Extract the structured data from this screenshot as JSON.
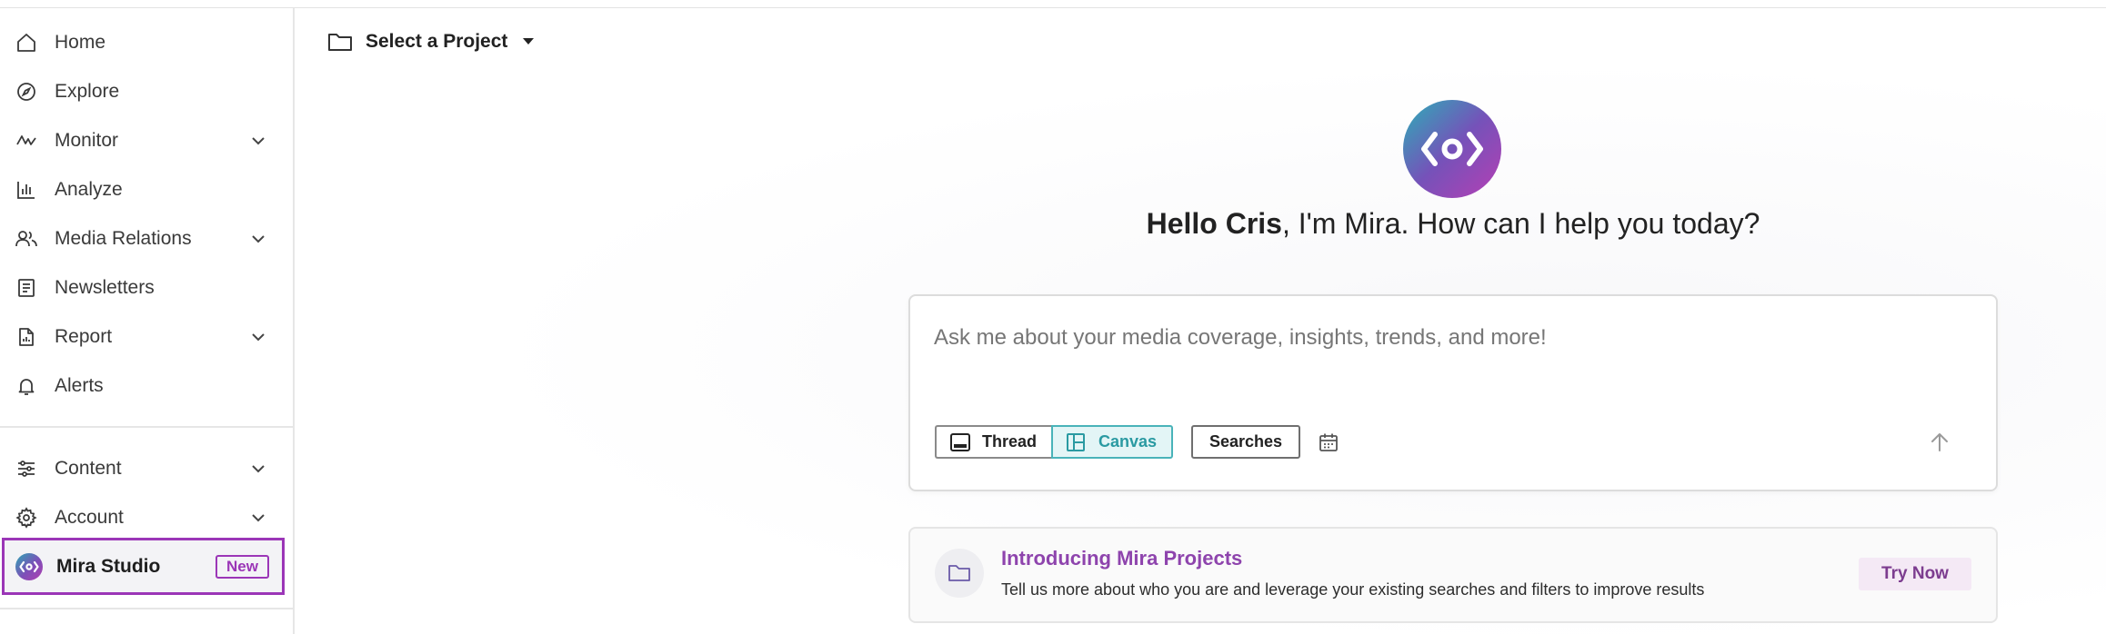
{
  "sidebar": {
    "items": [
      {
        "label": "Home",
        "icon": "home-icon"
      },
      {
        "label": "Explore",
        "icon": "compass-icon"
      },
      {
        "label": "Monitor",
        "icon": "pulse-icon"
      },
      {
        "label": "Analyze",
        "icon": "bar-chart-icon"
      },
      {
        "label": "Media Relations",
        "icon": "people-icon"
      },
      {
        "label": "Newsletters",
        "icon": "newsletter-icon"
      },
      {
        "label": "Report",
        "icon": "report-icon"
      },
      {
        "label": "Alerts",
        "icon": "bell-icon"
      },
      {
        "label": "Content",
        "icon": "sliders-icon"
      },
      {
        "label": "Account",
        "icon": "gear-icon"
      }
    ],
    "mira": {
      "label": "Mira Studio",
      "badge": "New"
    }
  },
  "project": {
    "label": "Select a Project"
  },
  "greeting": {
    "name": "Hello Cris",
    "rest": ", I'm Mira. How can I help you today?"
  },
  "chat": {
    "placeholder": "Ask me about your media coverage, insights, trends, and more!",
    "thread_label": "Thread",
    "canvas_label": "Canvas",
    "searches_label": "Searches"
  },
  "promo": {
    "title": "Introducing Mira Projects",
    "description": "Tell us more about who you are and leverage your existing searches and filters to improve results",
    "button": "Try Now"
  },
  "colors": {
    "accent": "#9b36b7",
    "canvas_teal": "#49b3b9",
    "promo_title": "#8e44ad"
  }
}
